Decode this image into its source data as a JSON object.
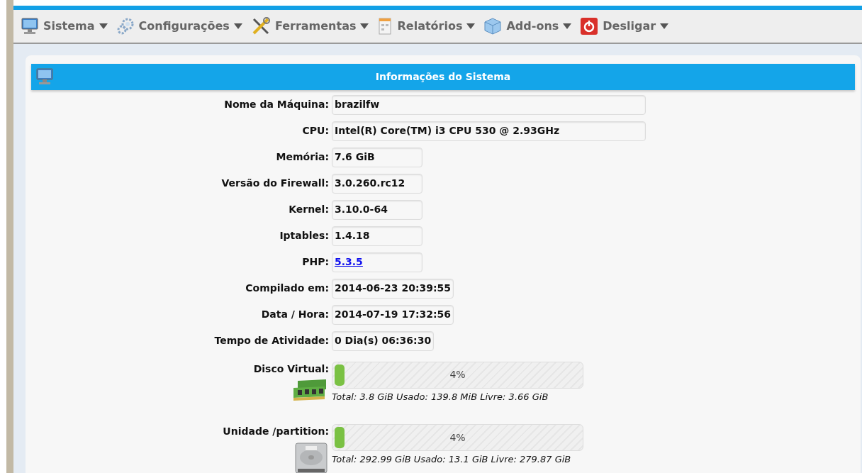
{
  "menu": [
    {
      "label": "Sistema",
      "kind": "monitor"
    },
    {
      "label": "Configurações",
      "kind": "gears"
    },
    {
      "label": "Ferramentas",
      "kind": "tools"
    },
    {
      "label": "Relatórios",
      "kind": "report"
    },
    {
      "label": "Add-ons",
      "kind": "cube"
    },
    {
      "label": "Desligar",
      "kind": "power"
    }
  ],
  "panel": {
    "title": "Informações do Sistema",
    "fields": [
      {
        "label": "Nome da Máquina:",
        "value": "brazilfw",
        "kind": "text"
      },
      {
        "label": "CPU:",
        "value": "Intel(R) Core(TM) i3 CPU 530 @ 2.93GHz",
        "kind": "text"
      },
      {
        "label": "Memória:",
        "value": "7.6 GiB",
        "kind": "text"
      },
      {
        "label": "Versão do Firewall:",
        "value": "3.0.260.rc12",
        "kind": "text"
      },
      {
        "label": "Kernel:",
        "value": "3.10.0-64",
        "kind": "text"
      },
      {
        "label": "Iptables:",
        "value": "1.4.18",
        "kind": "text"
      },
      {
        "label": "PHP:",
        "value": "5.3.5",
        "kind": "link"
      },
      {
        "label": "Compilado em:",
        "value": "2014-06-23 20:39:55",
        "kind": "text"
      },
      {
        "label": "Data / Hora:",
        "value": "2014-07-19 17:32:56",
        "kind": "text"
      },
      {
        "label": "Tempo de Atividade:",
        "value": "0 Dia(s) 06:36:30",
        "kind": "text"
      }
    ],
    "storage": [
      {
        "label": "Disco Virtual:",
        "kind": "ram",
        "level": 0.04,
        "percent": "4%",
        "detail": "Total: 3.8 GiB Usado: 139.8 MiB Livre: 3.66 GiB"
      },
      {
        "label": "Unidade /partition:",
        "kind": "disk",
        "level": 0.04,
        "percent": "4%",
        "detail": "Total: 292.99 GiB Usado: 13.1 GiB Livre: 279.87 GiB"
      }
    ]
  }
}
